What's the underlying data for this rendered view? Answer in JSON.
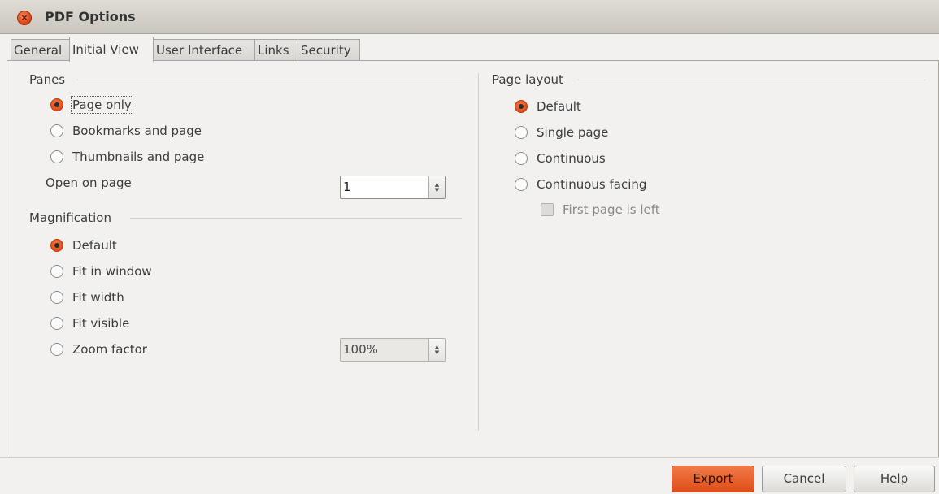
{
  "window": {
    "title": "PDF Options"
  },
  "tabs": [
    {
      "label": "General",
      "active": false
    },
    {
      "label": "Initial View",
      "active": true
    },
    {
      "label": "User Interface",
      "active": false
    },
    {
      "label": "Links",
      "active": false
    },
    {
      "label": "Security",
      "active": false
    }
  ],
  "panes": {
    "title": "Panes",
    "options": [
      {
        "label": "Page only",
        "checked": true
      },
      {
        "label": "Bookmarks and page",
        "checked": false
      },
      {
        "label": "Thumbnails and page",
        "checked": false
      }
    ],
    "open_on_page_label": "Open on page",
    "open_on_page_value": "1"
  },
  "magnification": {
    "title": "Magnification",
    "options": [
      {
        "label": "Default",
        "checked": true
      },
      {
        "label": "Fit in window",
        "checked": false
      },
      {
        "label": "Fit width",
        "checked": false
      },
      {
        "label": "Fit visible",
        "checked": false
      },
      {
        "label": "Zoom factor",
        "checked": false
      }
    ],
    "zoom_value": "100%"
  },
  "page_layout": {
    "title": "Page layout",
    "options": [
      {
        "label": "Default",
        "checked": true
      },
      {
        "label": "Single page",
        "checked": false
      },
      {
        "label": "Continuous",
        "checked": false
      },
      {
        "label": "Continuous facing",
        "checked": false
      }
    ],
    "first_page_left_label": "First page is left",
    "first_page_left_checked": false
  },
  "buttons": {
    "export": "Export",
    "cancel": "Cancel",
    "help": "Help"
  },
  "colors": {
    "accent": "#df4a16",
    "window_bg": "#f2f1f0"
  }
}
